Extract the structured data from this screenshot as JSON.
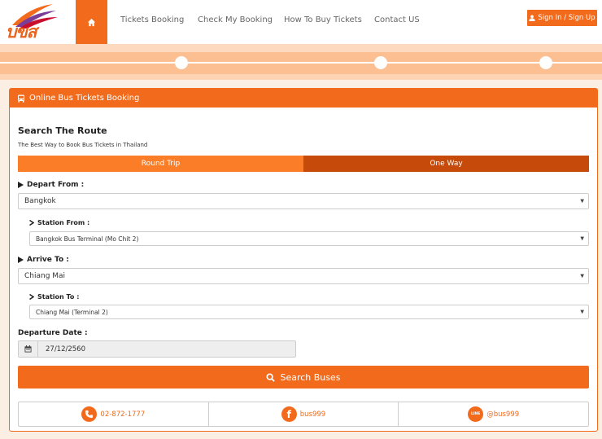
{
  "brand": {
    "logo_text": "บขส",
    "primary_color": "#f26b1d",
    "dark_color": "#c64b0a"
  },
  "nav": {
    "home_icon": "home-icon",
    "items": [
      {
        "label": "Tickets Booking"
      },
      {
        "label": "Check My Booking"
      },
      {
        "label": "How To Buy Tickets"
      },
      {
        "label": "Contact US"
      }
    ],
    "signin_label": "Sign In / Sign Up"
  },
  "panel": {
    "title": "Online Bus Tickets Booking",
    "section_title": "Search The Route",
    "section_subtitle": "The Best Way to Book Bus Tickets in Thailand"
  },
  "trip": {
    "round_label": "Round Trip",
    "one_way_label": "One Way",
    "selected": "One Way"
  },
  "form": {
    "depart_label": "Depart From :",
    "depart_value": "Bangkok",
    "station_from_label": "Station From :",
    "station_from_value": "Bangkok Bus Terminal (Mo Chit 2)",
    "arrive_label": "Arrive To :",
    "arrive_value": "Chiang Mai",
    "station_to_label": "Station To :",
    "station_to_value": "Chiang Mai (Terminal 2)",
    "date_label": "Departure Date :",
    "date_value": "27/12/2560",
    "search_label": "Search Buses"
  },
  "contacts": {
    "phone": "02-872-1777",
    "facebook": "bus999",
    "line": "@bus999",
    "line_icon_text": "LINE"
  }
}
